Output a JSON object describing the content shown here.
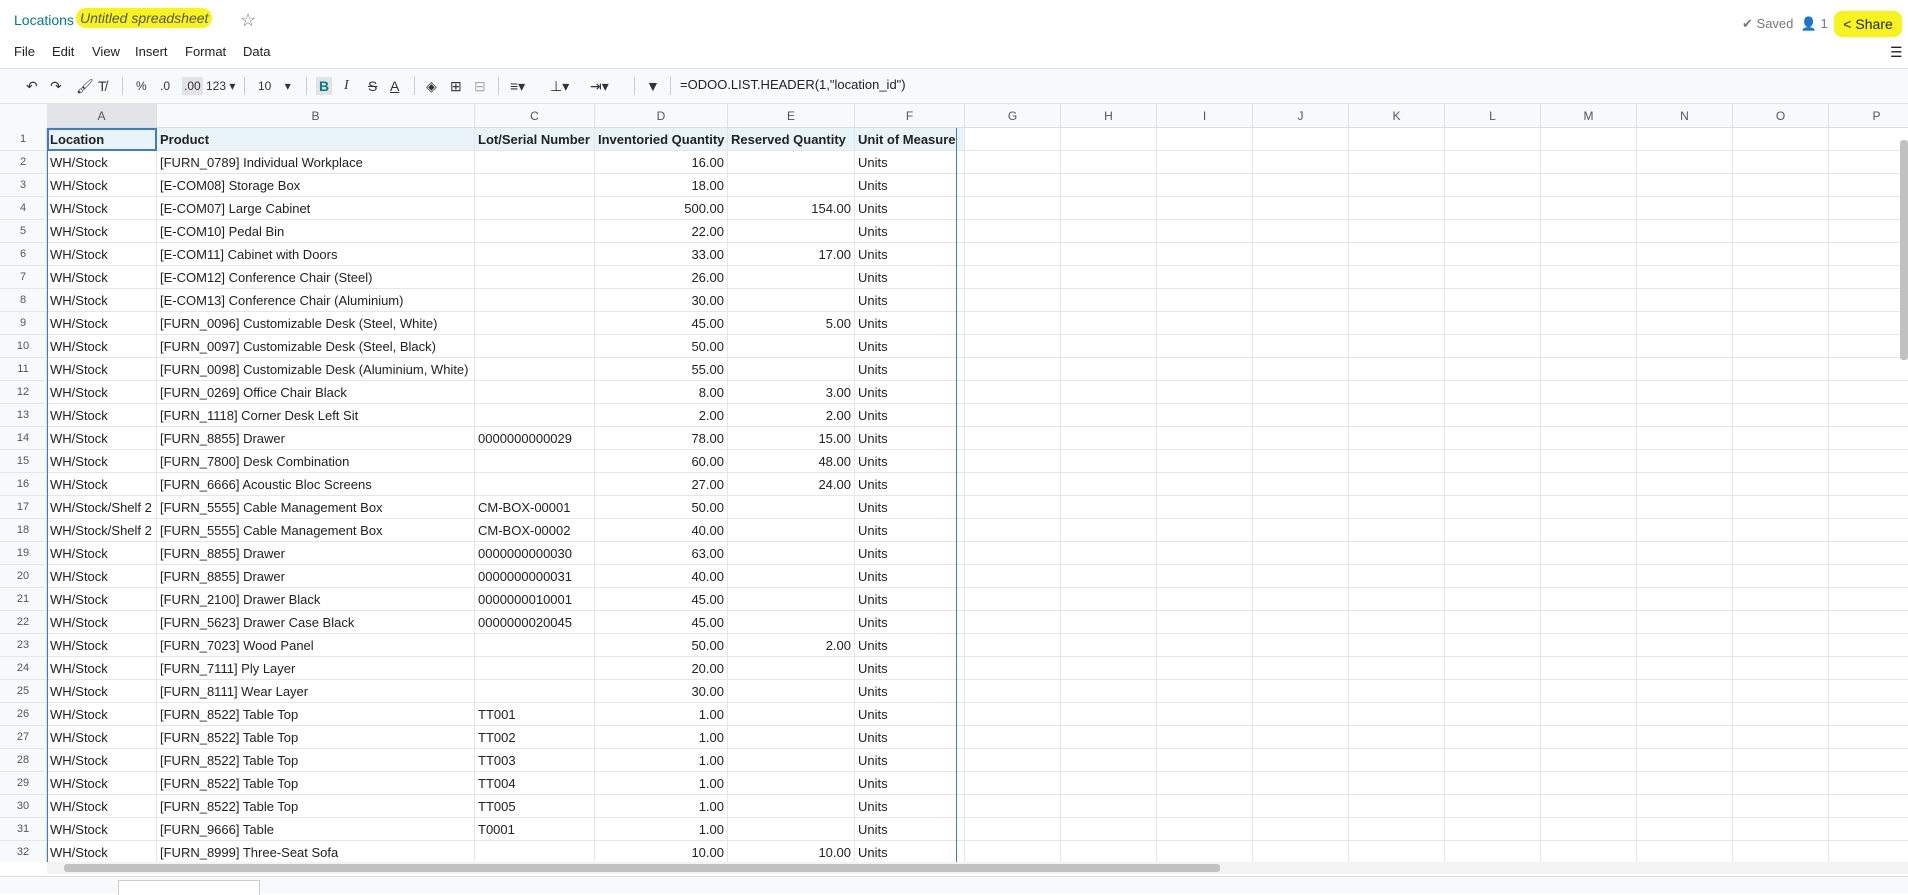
{
  "header": {
    "breadcrumb_parent": "Locations",
    "title": "Untitled spreadsheet",
    "saved_label": "Saved",
    "users_count": "1",
    "share_label": "Share"
  },
  "menu": [
    "File",
    "Edit",
    "View",
    "Insert",
    "Format",
    "Data"
  ],
  "toolbar": {
    "percent": "%",
    "decrease_decimal": ".0",
    "increase_decimal": ".00",
    "number_format": "123",
    "font_size": "10",
    "bold": "B",
    "italic": "I",
    "strike": "S",
    "text_color": "A",
    "formula": "=ODOO.LIST.HEADER(1,\"location_id\")"
  },
  "columns": [
    "A",
    "B",
    "C",
    "D",
    "E",
    "F",
    "G",
    "H",
    "I",
    "J",
    "K",
    "L",
    "M",
    "N",
    "O",
    "P"
  ],
  "table": {
    "headers": [
      "Location",
      "Product",
      "Lot/Serial Number",
      "Inventoried Quantity",
      "Reserved Quantity",
      "Unit of Measure"
    ],
    "rows": [
      [
        "WH/Stock",
        "[FURN_0789] Individual Workplace",
        "",
        "16.00",
        "",
        "Units"
      ],
      [
        "WH/Stock",
        "[E-COM08] Storage Box",
        "",
        "18.00",
        "",
        "Units"
      ],
      [
        "WH/Stock",
        "[E-COM07] Large Cabinet",
        "",
        "500.00",
        "154.00",
        "Units"
      ],
      [
        "WH/Stock",
        "[E-COM10] Pedal Bin",
        "",
        "22.00",
        "",
        "Units"
      ],
      [
        "WH/Stock",
        "[E-COM11] Cabinet with Doors",
        "",
        "33.00",
        "17.00",
        "Units"
      ],
      [
        "WH/Stock",
        "[E-COM12] Conference Chair (Steel)",
        "",
        "26.00",
        "",
        "Units"
      ],
      [
        "WH/Stock",
        "[E-COM13] Conference Chair (Aluminium)",
        "",
        "30.00",
        "",
        "Units"
      ],
      [
        "WH/Stock",
        "[FURN_0096] Customizable Desk (Steel, White)",
        "",
        "45.00",
        "5.00",
        "Units"
      ],
      [
        "WH/Stock",
        "[FURN_0097] Customizable Desk (Steel, Black)",
        "",
        "50.00",
        "",
        "Units"
      ],
      [
        "WH/Stock",
        "[FURN_0098] Customizable Desk (Aluminium, White)",
        "",
        "55.00",
        "",
        "Units"
      ],
      [
        "WH/Stock",
        "[FURN_0269] Office Chair Black",
        "",
        "8.00",
        "3.00",
        "Units"
      ],
      [
        "WH/Stock",
        "[FURN_1118] Corner Desk Left Sit",
        "",
        "2.00",
        "2.00",
        "Units"
      ],
      [
        "WH/Stock",
        "[FURN_8855] Drawer",
        "0000000000029",
        "78.00",
        "15.00",
        "Units"
      ],
      [
        "WH/Stock",
        "[FURN_7800] Desk Combination",
        "",
        "60.00",
        "48.00",
        "Units"
      ],
      [
        "WH/Stock",
        "[FURN_6666] Acoustic Bloc Screens",
        "",
        "27.00",
        "24.00",
        "Units"
      ],
      [
        "WH/Stock/Shelf 2",
        "[FURN_5555] Cable Management Box",
        "CM-BOX-00001",
        "50.00",
        "",
        "Units"
      ],
      [
        "WH/Stock/Shelf 2",
        "[FURN_5555] Cable Management Box",
        "CM-BOX-00002",
        "40.00",
        "",
        "Units"
      ],
      [
        "WH/Stock",
        "[FURN_8855] Drawer",
        "0000000000030",
        "63.00",
        "",
        "Units"
      ],
      [
        "WH/Stock",
        "[FURN_8855] Drawer",
        "0000000000031",
        "40.00",
        "",
        "Units"
      ],
      [
        "WH/Stock",
        "[FURN_2100] Drawer Black",
        "0000000010001",
        "45.00",
        "",
        "Units"
      ],
      [
        "WH/Stock",
        "[FURN_5623] Drawer Case Black",
        "0000000020045",
        "45.00",
        "",
        "Units"
      ],
      [
        "WH/Stock",
        "[FURN_7023] Wood Panel",
        "",
        "50.00",
        "2.00",
        "Units"
      ],
      [
        "WH/Stock",
        "[FURN_7111] Ply Layer",
        "",
        "20.00",
        "",
        "Units"
      ],
      [
        "WH/Stock",
        "[FURN_8111] Wear Layer",
        "",
        "30.00",
        "",
        "Units"
      ],
      [
        "WH/Stock",
        "[FURN_8522] Table Top",
        "TT001",
        "1.00",
        "",
        "Units"
      ],
      [
        "WH/Stock",
        "[FURN_8522] Table Top",
        "TT002",
        "1.00",
        "",
        "Units"
      ],
      [
        "WH/Stock",
        "[FURN_8522] Table Top",
        "TT003",
        "1.00",
        "",
        "Units"
      ],
      [
        "WH/Stock",
        "[FURN_8522] Table Top",
        "TT004",
        "1.00",
        "",
        "Units"
      ],
      [
        "WH/Stock",
        "[FURN_8522] Table Top",
        "TT005",
        "1.00",
        "",
        "Units"
      ],
      [
        "WH/Stock",
        "[FURN_9666] Table",
        "T0001",
        "1.00",
        "",
        "Units"
      ],
      [
        "WH/Stock",
        "[FURN_8999] Three-Seat Sofa",
        "",
        "10.00",
        "10.00",
        "Units"
      ]
    ]
  }
}
